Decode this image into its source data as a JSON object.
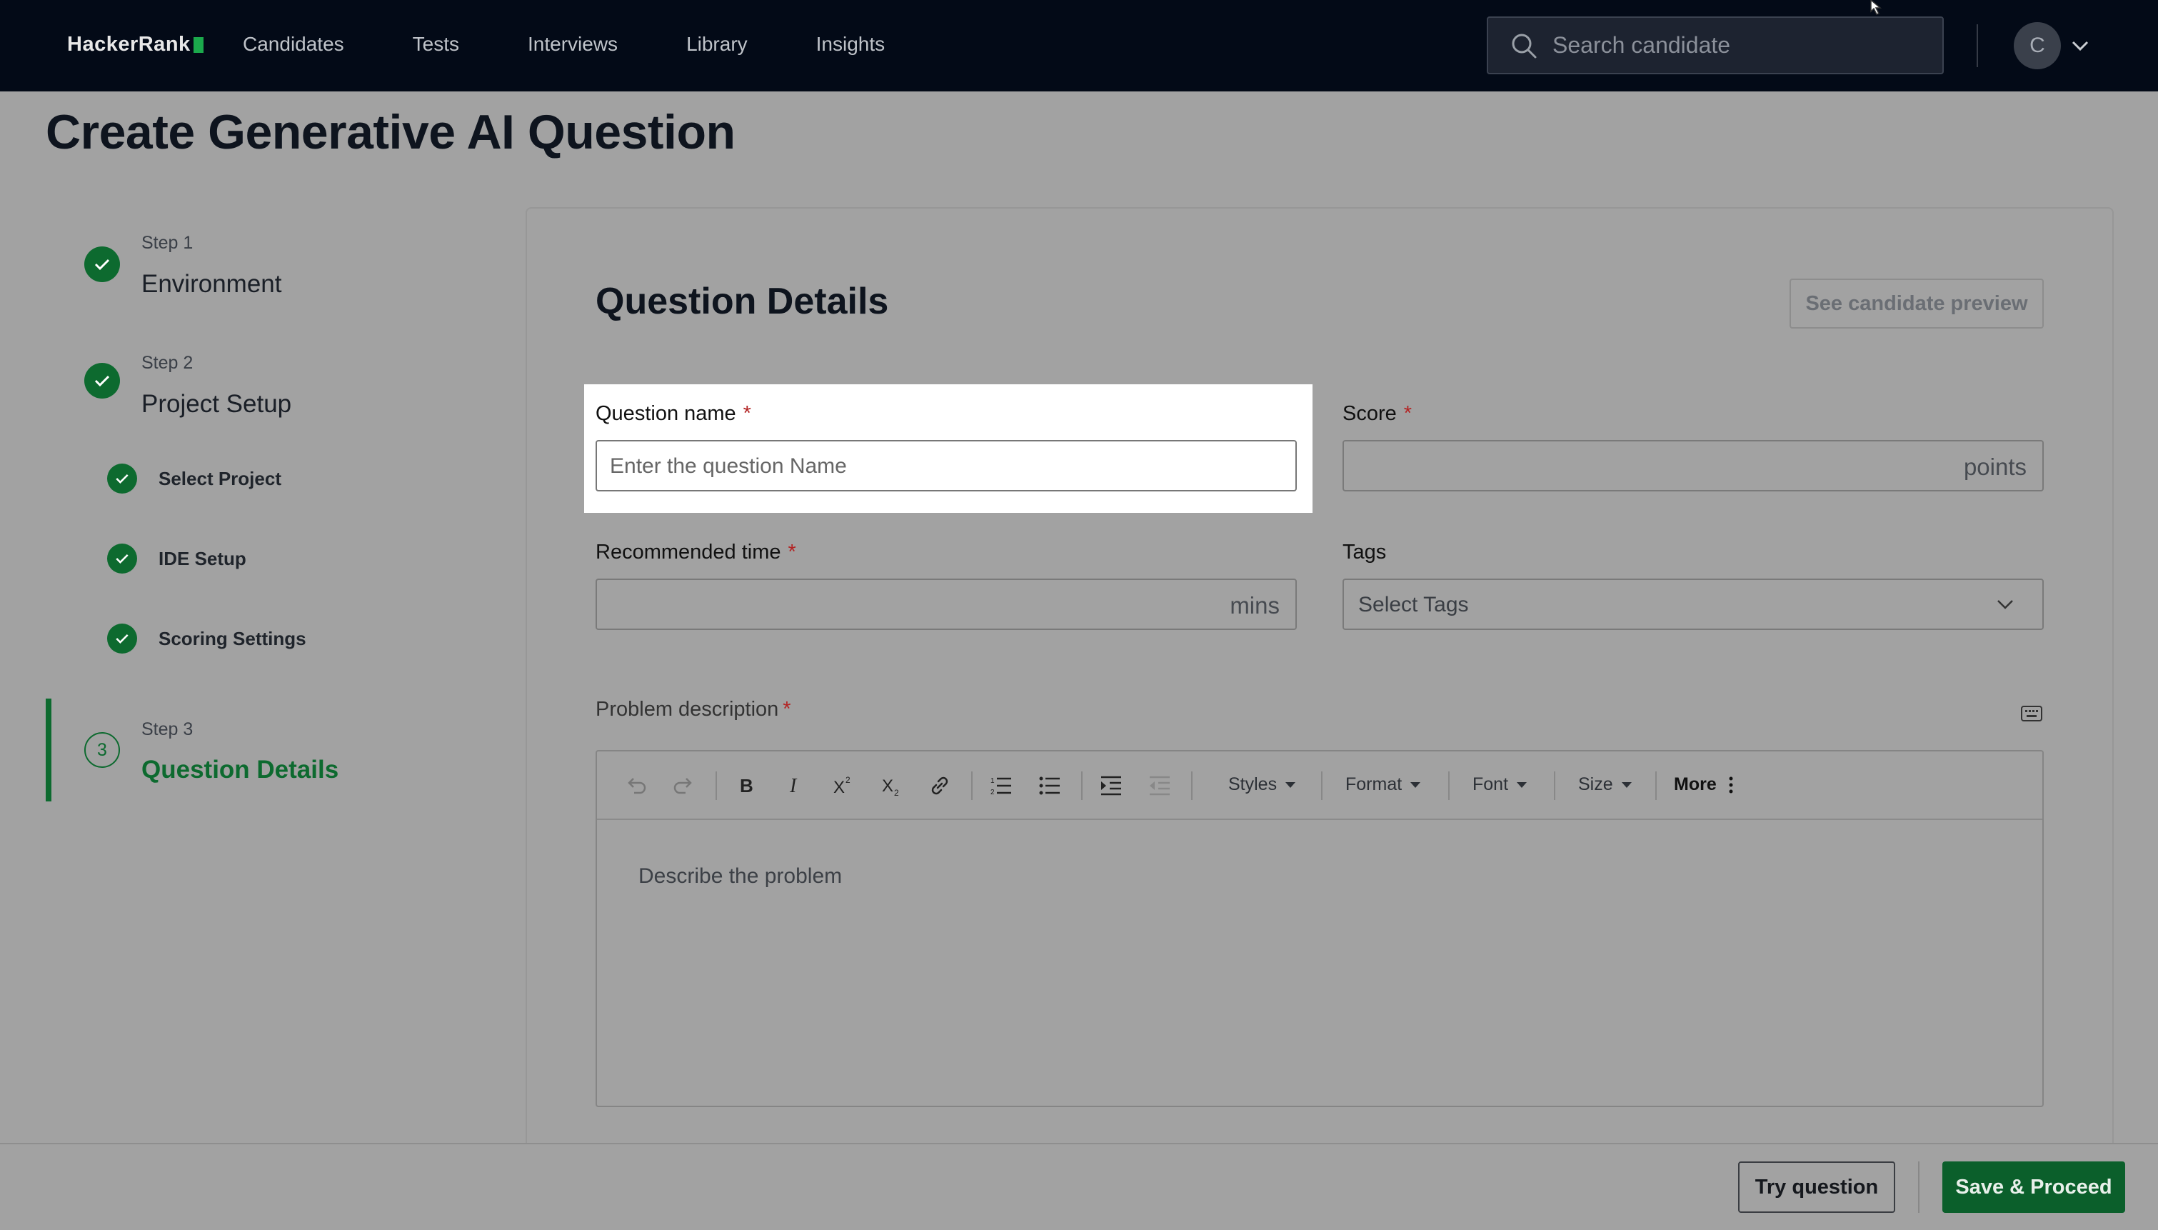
{
  "brand": {
    "name": "HackerRank",
    "accent": "#1ba94c"
  },
  "nav": {
    "links": [
      "Candidates",
      "Tests",
      "Interviews",
      "Library",
      "Insights"
    ],
    "search_placeholder": "Search candidate",
    "avatar_initial": "C"
  },
  "page": {
    "title": "Create Generative AI Question"
  },
  "steps": [
    {
      "small": "Step 1",
      "title": "Environment",
      "status": "done"
    },
    {
      "small": "Step 2",
      "title": "Project Setup",
      "status": "done",
      "substeps": [
        "Select Project",
        "IDE Setup",
        "Scoring Settings"
      ]
    },
    {
      "small": "Step 3",
      "title": "Question Details",
      "status": "active",
      "number": "3"
    }
  ],
  "form": {
    "section_title": "Question Details",
    "preview_button": "See candidate preview",
    "question_name": {
      "label": "Question name",
      "placeholder": "Enter the question Name"
    },
    "score": {
      "label": "Score",
      "suffix": "points"
    },
    "time": {
      "label": "Recommended time",
      "suffix": "mins"
    },
    "tags": {
      "label": "Tags",
      "placeholder": "Select Tags"
    },
    "description": {
      "label": "Problem description",
      "placeholder": "Describe the problem",
      "toolbar_dropdowns": [
        "Styles",
        "Format",
        "Font",
        "Size"
      ],
      "more": "More"
    },
    "required_marker": "*"
  },
  "footer": {
    "try": "Try question",
    "save": "Save & Proceed"
  },
  "colors": {
    "success": "#0d6a2f",
    "required": "#b32424",
    "nav_bg": "#030a17"
  }
}
